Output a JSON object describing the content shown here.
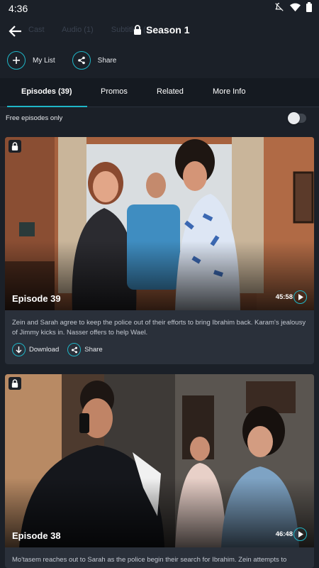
{
  "status_bar": {
    "time": "4:36"
  },
  "header": {
    "season_title": "Season 1",
    "faded_tabs": [
      "Cast",
      "Audio (1)",
      "Subtitles (1)"
    ]
  },
  "actions": {
    "my_list_label": "My List",
    "share_label": "Share"
  },
  "tabs": [
    {
      "label": "Episodes (39)",
      "active": true
    },
    {
      "label": "Promos",
      "active": false
    },
    {
      "label": "Related",
      "active": false
    },
    {
      "label": "More Info",
      "active": false
    }
  ],
  "filter": {
    "free_only_label": "Free episodes only",
    "free_only_enabled": false
  },
  "episodes": [
    {
      "title": "Episode 39",
      "duration": "45:58",
      "description": "Zein and Sarah agree to keep the police out of their efforts to bring Ibrahim back. Karam's jealousy of Jimmy kicks in. Nasser offers to help Wael.",
      "download_label": "Download",
      "share_label": "Share",
      "locked": true
    },
    {
      "title": "Episode 38",
      "duration": "46:48",
      "description": "Mo'tasem reaches out to Sarah as the police begin their search for Ibrahim. Zein attempts to",
      "locked": true
    }
  ],
  "colors": {
    "accent": "#1fb6c7",
    "background": "#1b2028",
    "card": "#2a303a",
    "tab_bar": "#151a21"
  }
}
